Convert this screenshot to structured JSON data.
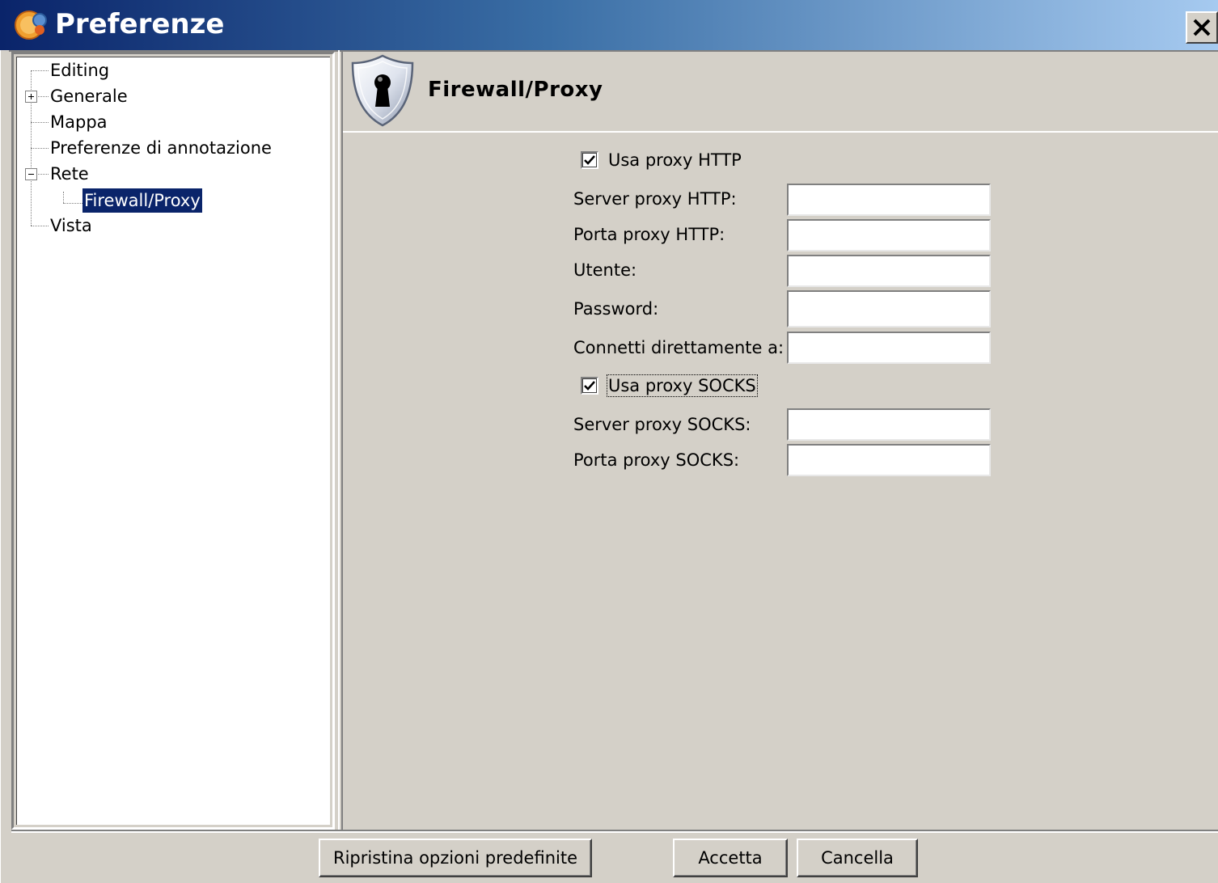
{
  "window": {
    "title": "Preferenze",
    "icon": "app-logo-icon",
    "close_icon": "close-icon"
  },
  "tree": {
    "items": [
      {
        "label": "Editing",
        "expander": null
      },
      {
        "label": "Generale",
        "expander": "plus"
      },
      {
        "label": "Mappa",
        "expander": null
      },
      {
        "label": "Preferenze di annotazione",
        "expander": null
      },
      {
        "label": "Rete",
        "expander": "minus"
      },
      {
        "label": "Firewall/Proxy",
        "expander": null,
        "selected": true
      },
      {
        "label": "Vista",
        "expander": null
      }
    ]
  },
  "header": {
    "title": "Firewall/Proxy",
    "icon": "shield-keyhole-icon"
  },
  "form": {
    "use_http": {
      "label": "Usa proxy HTTP",
      "checked": true
    },
    "http_server": {
      "label": "Server proxy HTTP:",
      "value": ""
    },
    "http_port": {
      "label": "Porta proxy HTTP:",
      "value": ""
    },
    "user": {
      "label": "Utente:",
      "value": ""
    },
    "password": {
      "label": "Password:",
      "value": ""
    },
    "direct": {
      "label": "Connetti direttamente a:",
      "value": ""
    },
    "use_socks": {
      "label": "Usa proxy SOCKS",
      "checked": true
    },
    "socks_server": {
      "label": "Server proxy SOCKS:",
      "value": ""
    },
    "socks_port": {
      "label": "Porta proxy SOCKS:",
      "value": ""
    }
  },
  "buttons": {
    "restore": "Ripristina opzioni predefinite",
    "accept": "Accetta",
    "cancel": "Cancella"
  },
  "colors": {
    "titlebar_start": "#0a246a",
    "titlebar_end": "#a6caf0",
    "selection": "#0a246a",
    "dialog_bg": "#d4d0c8"
  }
}
